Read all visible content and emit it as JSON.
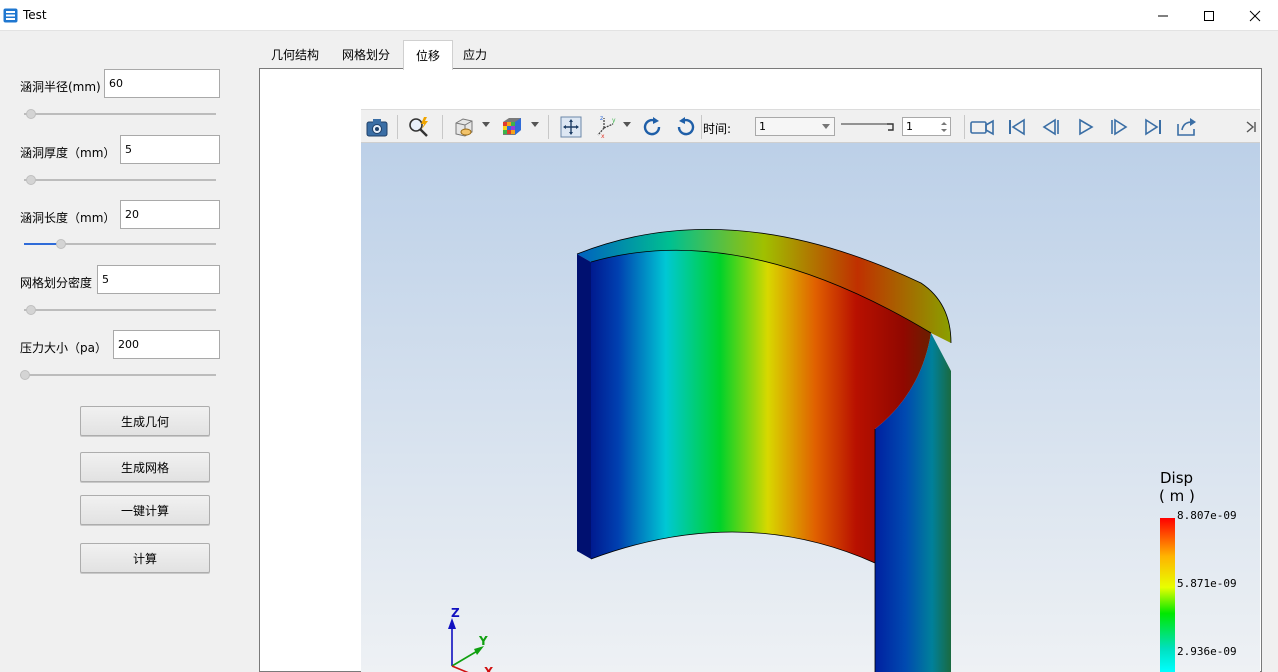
{
  "window": {
    "title": "Test"
  },
  "params": [
    {
      "label": "涵洞半径(mm)",
      "value": "60",
      "slider_fraction": 0.03
    },
    {
      "label": "涵洞厚度（mm）",
      "value": "5",
      "slider_fraction": 0.03
    },
    {
      "label": "涵洞长度（mm）",
      "value": "20",
      "slider_fraction": 0.19
    },
    {
      "label": "网格划分密度",
      "value": "5",
      "slider_fraction": 0.03
    },
    {
      "label": "压力大小（pa）",
      "value": "200",
      "slider_fraction": 0.0
    }
  ],
  "buttons": {
    "generate_geometry": "生成几何",
    "generate_mesh": "生成网格",
    "one_click_compute": "一键计算",
    "compute": "计算"
  },
  "tabs": [
    {
      "label": "几何结构",
      "active": false
    },
    {
      "label": "网格划分",
      "active": false
    },
    {
      "label": "位移",
      "active": true
    },
    {
      "label": "应力",
      "active": false
    }
  ],
  "viewer": {
    "time_label": "时间:",
    "time_value": "1",
    "step_value": "1",
    "toolbar_icons": [
      "camera-icon",
      "zoom-icon",
      "display-mode-icon",
      "color-map-icon",
      "fit-view-icon",
      "axes-icon",
      "rotate-cw-icon",
      "rotate-ccw-icon",
      "record-icon",
      "first-frame-icon",
      "prev-frame-icon",
      "play-icon",
      "next-frame-icon",
      "last-frame-icon",
      "export-icon"
    ],
    "legend": {
      "title": "Disp",
      "unit": "( m )",
      "ticks": [
        "8.807e-09",
        "5.871e-09",
        "2.936e-09"
      ]
    },
    "axes": {
      "z": "Z",
      "y": "Y",
      "x": "X"
    }
  },
  "colors": {
    "accent": "#2f6bd8"
  }
}
